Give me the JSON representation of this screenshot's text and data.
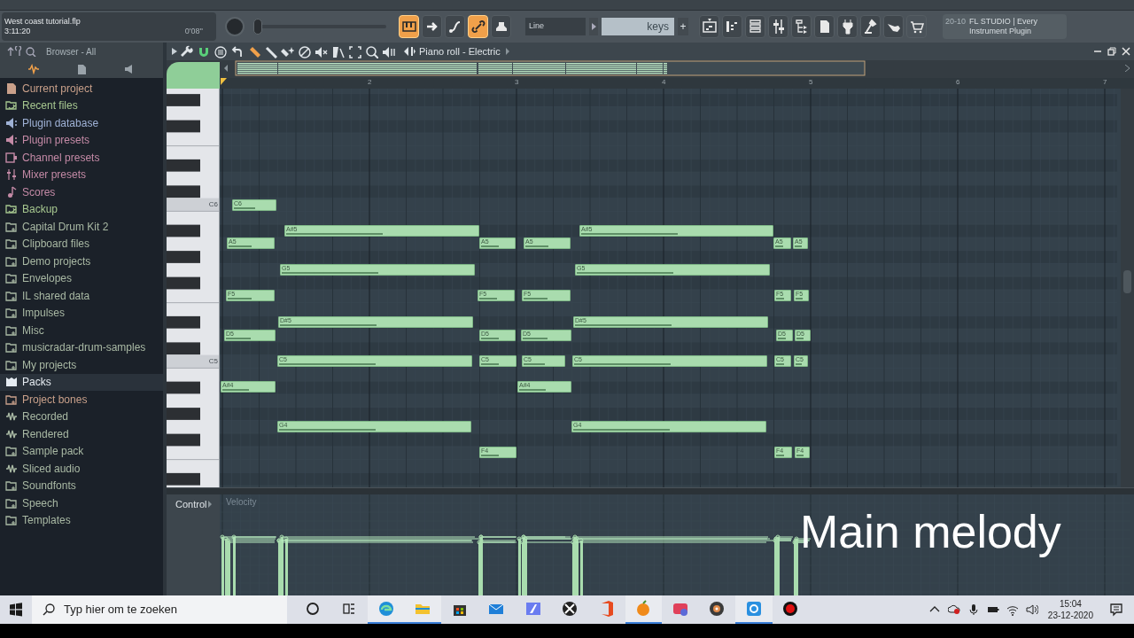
{
  "toolbar": {
    "project_file": "West coast tutorial.flp",
    "song_time": "3:11:20",
    "duration": "0'08''",
    "mode_buttons": [
      {
        "kind": "piano",
        "on": true
      },
      {
        "kind": "arrow",
        "on": false
      },
      {
        "kind": "tail",
        "on": false
      },
      {
        "kind": "link",
        "on": true
      },
      {
        "kind": "stamp",
        "on": false
      }
    ],
    "volume_slider": {
      "level": 0.0
    },
    "snap_mode": "Line",
    "pattern_field": "keys",
    "add_label": "+",
    "hint": {
      "code": "20-10",
      "text": "FL STUDIO | Every Instrument Plugin"
    }
  },
  "browser": {
    "title": "Browser - All",
    "items": [
      {
        "label": "Current project",
        "kind": "file",
        "color": "#c9a08a",
        "selected": false
      },
      {
        "label": "Recent files",
        "kind": "recent",
        "color": "#a7c890",
        "selected": false
      },
      {
        "label": "Plugin database",
        "kind": "plugin",
        "color": "#9fb2d6",
        "selected": false
      },
      {
        "label": "Plugin presets",
        "kind": "plugin",
        "color": "#c48aa6",
        "selected": false
      },
      {
        "label": "Channel presets",
        "kind": "channel",
        "color": "#c48aa6",
        "selected": false
      },
      {
        "label": "Mixer presets",
        "kind": "mixer",
        "color": "#c48aa6",
        "selected": false
      },
      {
        "label": "Scores",
        "kind": "note",
        "color": "#c48aa6",
        "selected": false
      },
      {
        "label": "Backup",
        "kind": "recent",
        "color": "#a7c890",
        "selected": false
      },
      {
        "label": "Capital Drum Kit 2",
        "kind": "folder",
        "color": "#a9b9a4",
        "selected": false
      },
      {
        "label": "Clipboard files",
        "kind": "folder",
        "color": "#a9b9a4",
        "selected": false
      },
      {
        "label": "Demo projects",
        "kind": "folder",
        "color": "#a9b9a4",
        "selected": false
      },
      {
        "label": "Envelopes",
        "kind": "folder",
        "color": "#a9b9a4",
        "selected": false
      },
      {
        "label": "IL shared data",
        "kind": "folder",
        "color": "#a9b9a4",
        "selected": false
      },
      {
        "label": "Impulses",
        "kind": "folder",
        "color": "#a9b9a4",
        "selected": false
      },
      {
        "label": "Misc",
        "kind": "folder",
        "color": "#a9b9a4",
        "selected": false
      },
      {
        "label": "musicradar-drum-samples",
        "kind": "folder",
        "color": "#a9b9a4",
        "selected": false
      },
      {
        "label": "My projects",
        "kind": "folder",
        "color": "#a9b9a4",
        "selected": false
      },
      {
        "label": "Packs",
        "kind": "packs",
        "color": "#e6ecf2",
        "selected": true
      },
      {
        "label": "Project bones",
        "kind": "folder",
        "color": "#c9a08a",
        "selected": false
      },
      {
        "label": "Recorded",
        "kind": "audio",
        "color": "#a9b9a4",
        "selected": false
      },
      {
        "label": "Rendered",
        "kind": "audio",
        "color": "#a9b9a4",
        "selected": false
      },
      {
        "label": "Sample pack",
        "kind": "folder",
        "color": "#a9b9a4",
        "selected": false
      },
      {
        "label": "Sliced audio",
        "kind": "audio",
        "color": "#a9b9a4",
        "selected": false
      },
      {
        "label": "Soundfonts",
        "kind": "folder",
        "color": "#a9b9a4",
        "selected": false
      },
      {
        "label": "Speech",
        "kind": "folder",
        "color": "#a9b9a4",
        "selected": false
      },
      {
        "label": "Templates",
        "kind": "folder",
        "color": "#a9b9a4",
        "selected": false
      }
    ]
  },
  "piano_roll": {
    "title": "Piano roll - Electric",
    "ruler": [
      "2",
      "3",
      "4",
      "5",
      "6",
      "7"
    ],
    "key_labels": [
      "C6",
      "C5"
    ],
    "notes": [
      {
        "label": "C6"
      },
      {
        "label": "A#5"
      },
      {
        "label": "A#5"
      },
      {
        "label": "A5"
      },
      {
        "label": "A5"
      },
      {
        "label": "A5"
      },
      {
        "label": "A5"
      },
      {
        "label": "A5"
      },
      {
        "label": "G5"
      },
      {
        "label": "G5"
      },
      {
        "label": "F5"
      },
      {
        "label": "F5"
      },
      {
        "label": "F5"
      },
      {
        "label": "F5"
      },
      {
        "label": "F5"
      },
      {
        "label": "D#5"
      },
      {
        "label": "D#5"
      },
      {
        "label": "D5"
      },
      {
        "label": "D5"
      },
      {
        "label": "D5"
      },
      {
        "label": "D5"
      },
      {
        "label": "D5"
      },
      {
        "label": "C5"
      },
      {
        "label": "C5"
      },
      {
        "label": "C5"
      },
      {
        "label": "C5"
      },
      {
        "label": "C5"
      },
      {
        "label": "C5"
      },
      {
        "label": "A#4"
      },
      {
        "label": "A#4"
      },
      {
        "label": "G4"
      },
      {
        "label": "G4"
      },
      {
        "label": "F4"
      },
      {
        "label": "F4"
      },
      {
        "label": "F4"
      }
    ],
    "control": {
      "label": "Control",
      "parameter": "Velocity"
    }
  },
  "caption": "Main melody",
  "taskbar": {
    "search_placeholder": "Typ hier om te zoeken",
    "time": "15:04",
    "date": "23-12-2020",
    "apps": [
      {
        "kind": "circle",
        "active": false
      },
      {
        "kind": "taskview",
        "active": false
      },
      {
        "kind": "browser",
        "active": true
      },
      {
        "kind": "folder",
        "active": true
      },
      {
        "kind": "store",
        "active": false
      },
      {
        "kind": "mail",
        "active": false
      },
      {
        "kind": "app",
        "active": false
      },
      {
        "kind": "xbox",
        "active": false
      },
      {
        "kind": "office",
        "active": false
      },
      {
        "kind": "fruit",
        "active": true
      },
      {
        "kind": "game",
        "active": false
      },
      {
        "kind": "disc",
        "active": false
      },
      {
        "kind": "camera",
        "active": true
      },
      {
        "kind": "record",
        "active": false
      }
    ]
  }
}
